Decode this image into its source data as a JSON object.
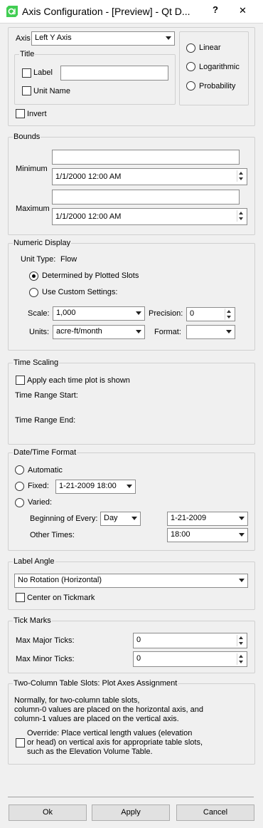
{
  "window": {
    "title": "Axis Configuration - [Preview] - Qt D...",
    "help_glyph": "?",
    "close_glyph": "✕"
  },
  "axis": {
    "label": "Axis",
    "selected": "Left Y Axis",
    "title_group": "Title",
    "label_check": "Label",
    "label_value": "",
    "unit_name_check": "Unit Name",
    "invert_check": "Invert",
    "scale_options": [
      "Linear",
      "Logarithmic",
      "Probability"
    ]
  },
  "bounds": {
    "title": "Bounds",
    "minimum_label": "Minimum",
    "minimum_text": "",
    "minimum_datetime": "1/1/2000 12:00 AM",
    "maximum_label": "Maximum",
    "maximum_text": "",
    "maximum_datetime": "1/1/2000 12:00 AM"
  },
  "numeric_display": {
    "title": "Numeric Display",
    "unit_type_label": "Unit Type:",
    "unit_type_value": "Flow",
    "determined_radio": "Determined by Plotted Slots",
    "custom_radio": "Use Custom Settings:",
    "scale_label": "Scale:",
    "scale_value": "1,000",
    "precision_label": "Precision:",
    "precision_value": "0",
    "units_label": "Units:",
    "units_value": "acre-ft/month",
    "format_label": "Format:",
    "format_value": ""
  },
  "time_scaling": {
    "title": "Time Scaling",
    "apply_check": "Apply each time plot is shown",
    "range_start_label": "Time Range Start:",
    "range_end_label": "Time Range End:"
  },
  "date_time_format": {
    "title": "Date/Time Format",
    "automatic_radio": "Automatic",
    "fixed_radio": "Fixed:",
    "fixed_value": "1-21-2009 18:00",
    "varied_radio": "Varied:",
    "beginning_label": "Beginning of Every:",
    "beginning_unit": "Day",
    "beginning_format": "1-21-2009",
    "other_times_label": "Other Times:",
    "other_times_format": "18:00"
  },
  "label_angle": {
    "title": "Label Angle",
    "rotation_value": "No Rotation (Horizontal)",
    "center_check": "Center on Tickmark"
  },
  "tick_marks": {
    "title": "Tick Marks",
    "max_major_label": "Max Major Ticks:",
    "max_major_value": "0",
    "max_minor_label": "Max Minor Ticks:",
    "max_minor_value": "0"
  },
  "two_column": {
    "title": "Two-Column Table Slots: Plot Axes Assignment",
    "desc_line1": "Normally, for two-column table slots,",
    "desc_line2": "column-0 values are placed on the horizontal axis, and",
    "desc_line3": "column-1 values are placed on the vertical axis.",
    "override_line1": "Override: Place vertical length values (elevation",
    "override_line2": "or head) on vertical axis for appropriate table slots,",
    "override_line3": "such as the Elevation Volume Table."
  },
  "buttons": {
    "ok": "Ok",
    "apply": "Apply",
    "cancel": "Cancel"
  },
  "colors": {
    "qt_green": "#41cd52",
    "dialog_bg": "#f0f0f0"
  }
}
